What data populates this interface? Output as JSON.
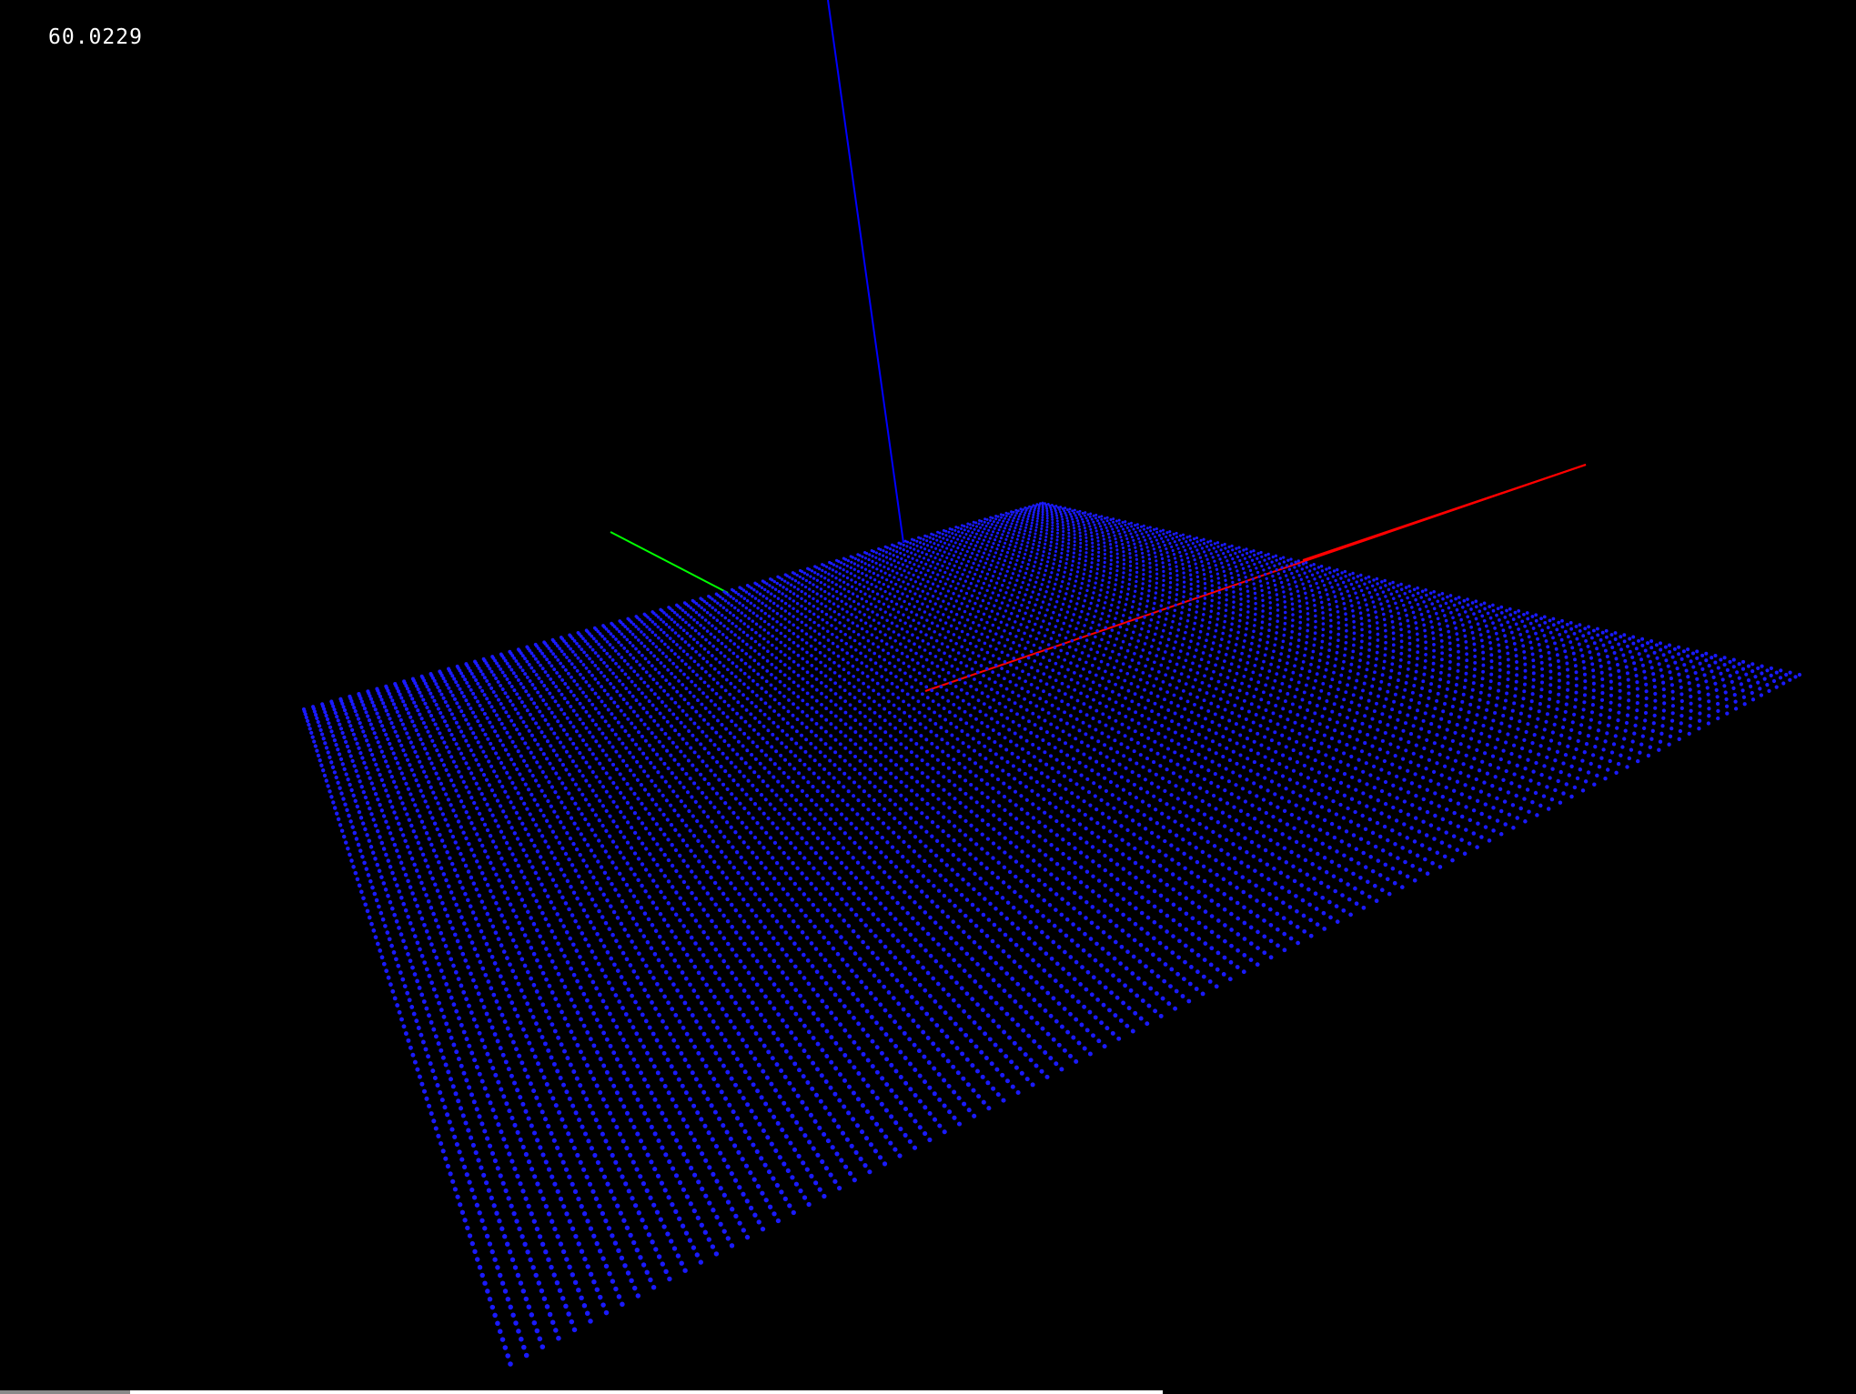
{
  "fps": {
    "value": "60.0229"
  },
  "scene": {
    "background": "#000000",
    "point_color": "#1a1aff",
    "axes": {
      "x_color": "#ff0000",
      "y_color": "#00ff00",
      "z_color": "#0000ff"
    }
  },
  "footer": {
    "bar_color": "#ffffff"
  }
}
